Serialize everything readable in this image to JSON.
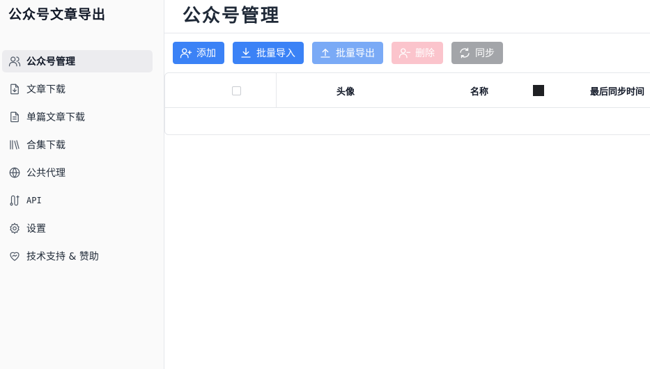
{
  "app": {
    "title": "公众号文章导出"
  },
  "sidebar": {
    "items": [
      {
        "label": "公众号管理",
        "icon": "users-icon",
        "active": true
      },
      {
        "label": "文章下载",
        "icon": "file-download-icon"
      },
      {
        "label": "单篇文章下载",
        "icon": "file-text-icon"
      },
      {
        "label": "合集下载",
        "icon": "library-icon"
      },
      {
        "label": "公共代理",
        "icon": "globe-icon"
      },
      {
        "label": "API",
        "icon": "api-route-icon"
      },
      {
        "label": "设置",
        "icon": "gear-icon"
      },
      {
        "label": "技术支持 & 赞助",
        "icon": "heart-handshake-icon"
      }
    ]
  },
  "main": {
    "page_title": "公众号管理",
    "toolbar": {
      "add_label": "添加",
      "import_label": "批量导入",
      "export_label": "批量导出",
      "delete_label": "删除",
      "sync_label": "同步"
    },
    "table": {
      "columns": {
        "avatar": "头像",
        "name": "名称",
        "last_sync": "最后同步时间"
      },
      "rows": []
    }
  },
  "colors": {
    "primary": "#3b82f6",
    "primary_disabled": "#7aaaf6",
    "danger_disabled": "#fbc4cc",
    "neutral_disabled": "#a3a5a9"
  }
}
